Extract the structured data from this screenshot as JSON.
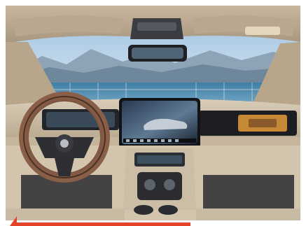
{
  "image": {
    "subject": "car-interior",
    "colors": {
      "accent": "#e5432a",
      "sky": "#8fb6d6",
      "lake": "#4f87a8",
      "trim": "#cdbfa8",
      "dash": "#2b2c30",
      "leather": "#6e4a39"
    },
    "icons": [
      "steering-wheel-icon",
      "center-screen-icon",
      "rearview-mirror-icon"
    ]
  }
}
